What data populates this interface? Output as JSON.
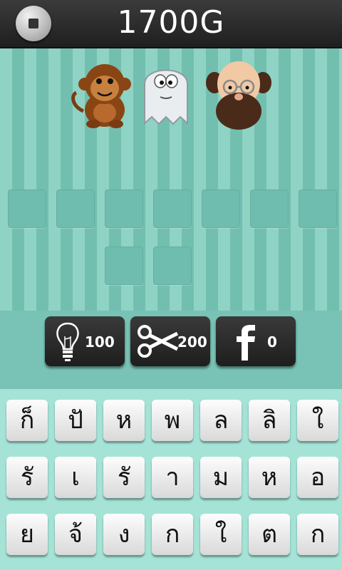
{
  "header": {
    "score": "1700G",
    "menu_icon": "stop-icon"
  },
  "pictures": [
    "monkey-icon",
    "ghost-icon",
    "bald-man-icon"
  ],
  "answer_slots": {
    "row1_count": 7,
    "row2_count": 2
  },
  "tools": [
    {
      "icon": "lightbulb-icon",
      "cost": "100"
    },
    {
      "icon": "scissors-icon",
      "cost": "200"
    },
    {
      "icon": "facebook-icon",
      "cost": "0"
    }
  ],
  "letters": [
    [
      "ก็",
      "ปั",
      "ห",
      "พ",
      "ล",
      "ลิ",
      "ใ"
    ],
    [
      "รั",
      "เ",
      "รั",
      "า",
      "ม",
      "ห",
      "อ"
    ],
    [
      "ย",
      "จ้",
      "ง",
      "ก",
      "ใ",
      "ต",
      "ก"
    ]
  ],
  "colors": {
    "topbar": "#2a2a2a",
    "stripe_light": "#8fd3c5",
    "stripe_dark": "#72bfb0",
    "slot": "#6fbdaf",
    "keyboard_bg": "#a4e3d6"
  }
}
